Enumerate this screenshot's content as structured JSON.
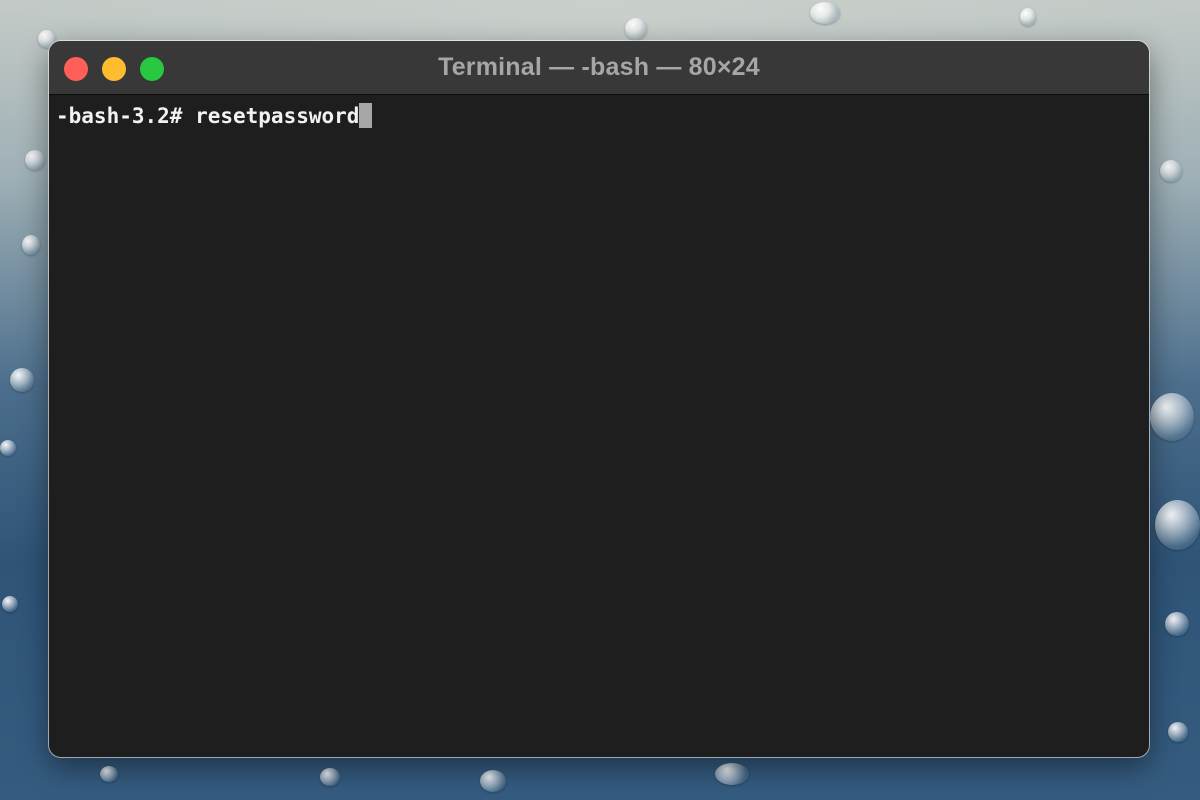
{
  "window": {
    "title": "Terminal — -bash — 80×24"
  },
  "terminal": {
    "prompt": "-bash-3.2# ",
    "command": "resetpassword"
  },
  "colors": {
    "close": "#fe5f57",
    "minimize": "#febc2e",
    "zoom": "#28c840",
    "terminal_background": "#1e1e1e",
    "titlebar": "#383838",
    "text": "#f2f2f2",
    "cursor": "#a7a7a7"
  },
  "icons": {
    "close": "close-button-icon",
    "minimize": "minimize-button-icon",
    "zoom": "zoom-button-icon"
  }
}
